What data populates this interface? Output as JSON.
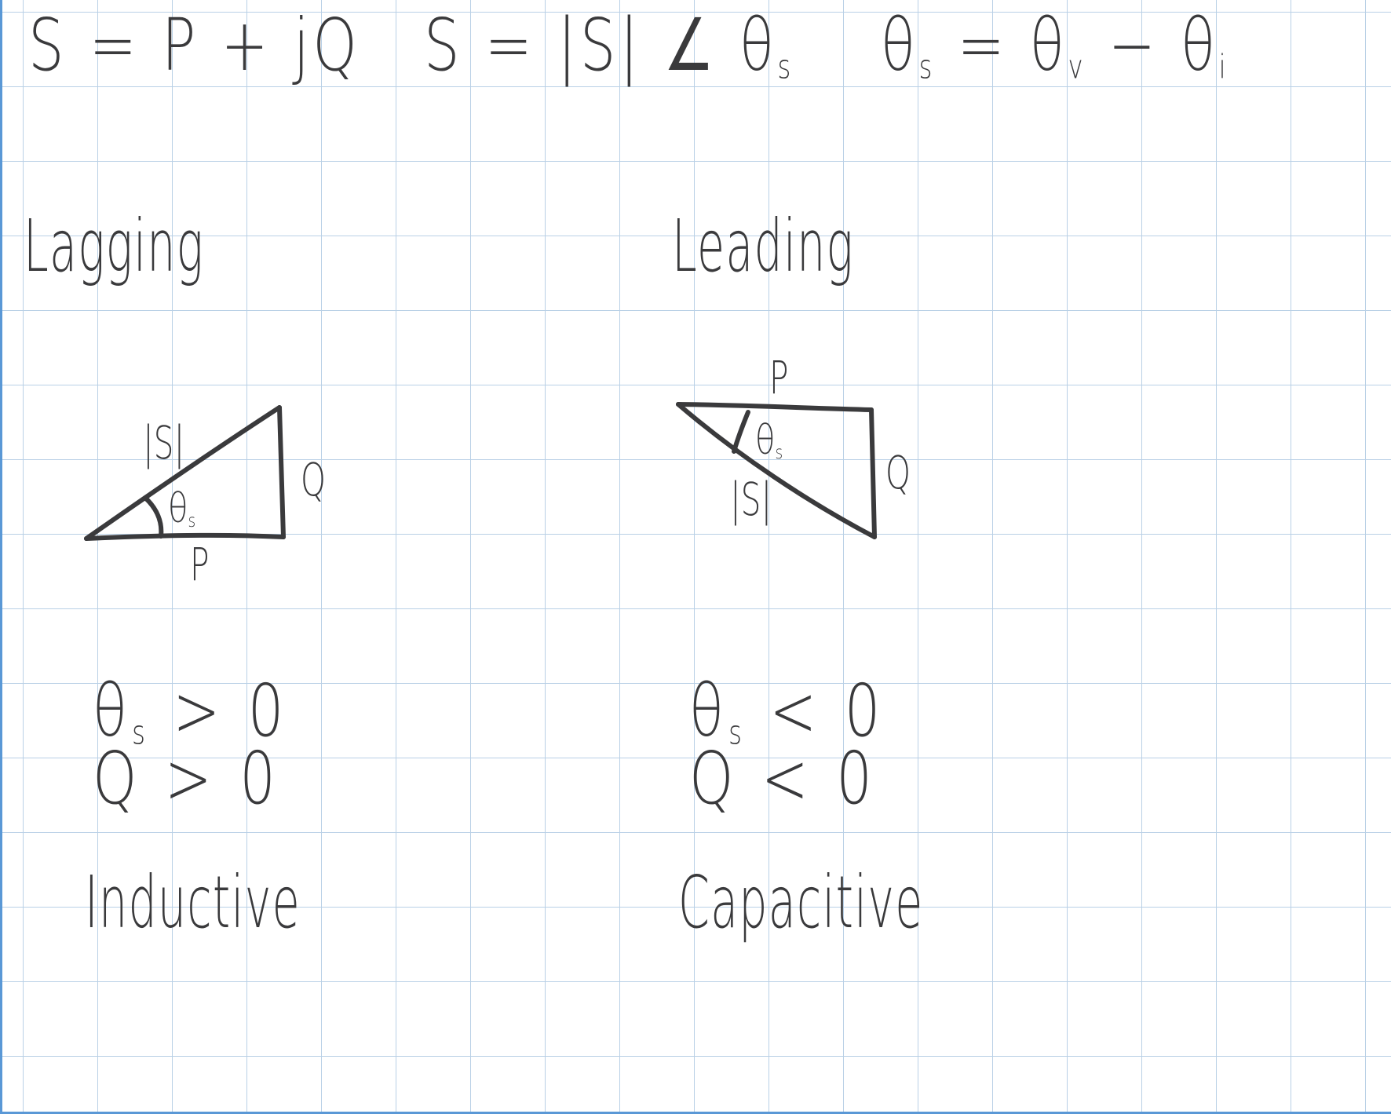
{
  "equations": {
    "eq1": "S = P + jQ",
    "eq2": "S = |S| ∠ θ",
    "eq2_sub": "s",
    "eq3_a": "θ",
    "eq3_a_sub": "s",
    "eq3_b": " = θ",
    "eq3_b_sub": "v",
    "eq3_c": " − θ",
    "eq3_c_sub": "i"
  },
  "lagging": {
    "heading": "Lagging",
    "hyp_label": "|S|",
    "opp_label": "Q",
    "adj_label": "P",
    "angle_label": "θ",
    "angle_sub": "s",
    "cond1_a": "θ",
    "cond1_sub": "s",
    "cond1_b": " > 0",
    "cond2": "Q > 0",
    "type": "Inductive"
  },
  "leading": {
    "heading": "Leading",
    "hyp_label": "|S|",
    "opp_label": "Q",
    "adj_label": "P",
    "angle_label": "θ",
    "angle_sub": "s",
    "cond1_a": "θ",
    "cond1_sub": "s",
    "cond1_b": " < 0",
    "cond2": "Q < 0",
    "type": "Capacitive"
  },
  "colors": {
    "ink": "#3a3a3c",
    "grid": "#b9d0e6",
    "edge": "#5a98d6"
  }
}
